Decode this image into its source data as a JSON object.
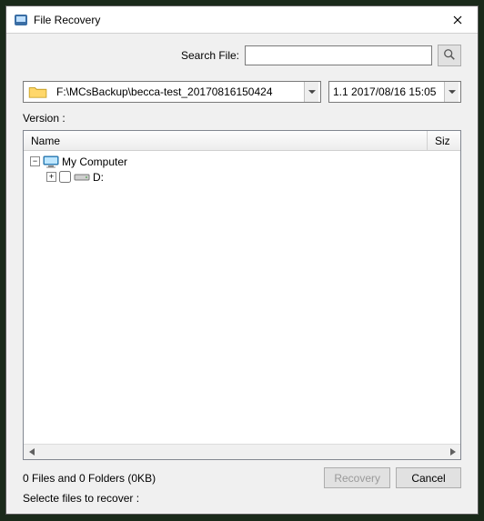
{
  "window": {
    "title": "File Recovery"
  },
  "search": {
    "label": "Search File:",
    "value": "",
    "placeholder": ""
  },
  "path_combo": {
    "value": "F:\\MCsBackup\\becca-test_20170816150424"
  },
  "version_combo": {
    "value": "1.1  2017/08/16 15:05"
  },
  "version_label": "Version :",
  "columns": {
    "name": "Name",
    "size": "Siz"
  },
  "tree": {
    "root": {
      "label": "My Computer",
      "children": [
        {
          "label": "D:"
        }
      ]
    }
  },
  "footer": {
    "status": "0 Files and  0 Folders (0KB)",
    "instruction": "Selecte files to recover :",
    "recovery_label": "Recovery",
    "cancel_label": "Cancel"
  }
}
